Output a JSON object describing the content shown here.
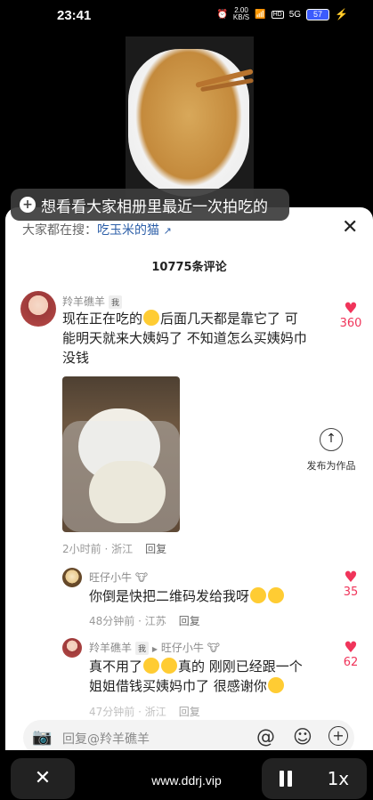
{
  "status": {
    "time": "23:41",
    "net_speed": "2.00",
    "net_unit": "KB/S",
    "hd": "HD",
    "signal": "5G",
    "battery": "57"
  },
  "video": {
    "title_pill": "想看看大家相册里最近一次拍吃的"
  },
  "sheet": {
    "search_prefix": "大家都在搜：",
    "search_term": "吃玉米的猫",
    "search_icon": "search-arrow-icon",
    "comment_count_label": "10775条评论",
    "publish_label": "发布为作品"
  },
  "comments": [
    {
      "author": "羚羊礁羊",
      "author_tag": "我",
      "text_line1_a": "现在正在吃的",
      "text_line1_b": "后面几天都是靠它了 可",
      "text_line2": "能明天就来大姨妈了 不知道怎么买姨妈巾",
      "text_line3": "没钱",
      "meta": "2小时前 · 浙江",
      "reply_label": "回复",
      "likes": "360"
    },
    {
      "author": "旺仔小牛",
      "text_a": "你倒是快把二维码发给我呀",
      "meta": "48分钟前 · 江苏",
      "reply_label": "回复",
      "likes": "35"
    },
    {
      "author": "羚羊礁羊",
      "author_tag": "我",
      "reply_to": "旺仔小牛",
      "text_line1_a": "真不用了",
      "text_line1_b": "真的 刚刚已经跟一个",
      "text_line2": "姐姐借钱买姨妈巾了 很感谢你",
      "meta": "47分钟前 · 浙江",
      "reply_label": "回复",
      "likes": "62"
    }
  ],
  "input": {
    "placeholder": "回复@羚羊礁羊"
  },
  "controls": {
    "url": "www.ddrj.vip",
    "speed": "1x"
  },
  "colors": {
    "like": "#f0345a",
    "link": "#2d5fa8",
    "battery": "#3b5bfd"
  }
}
